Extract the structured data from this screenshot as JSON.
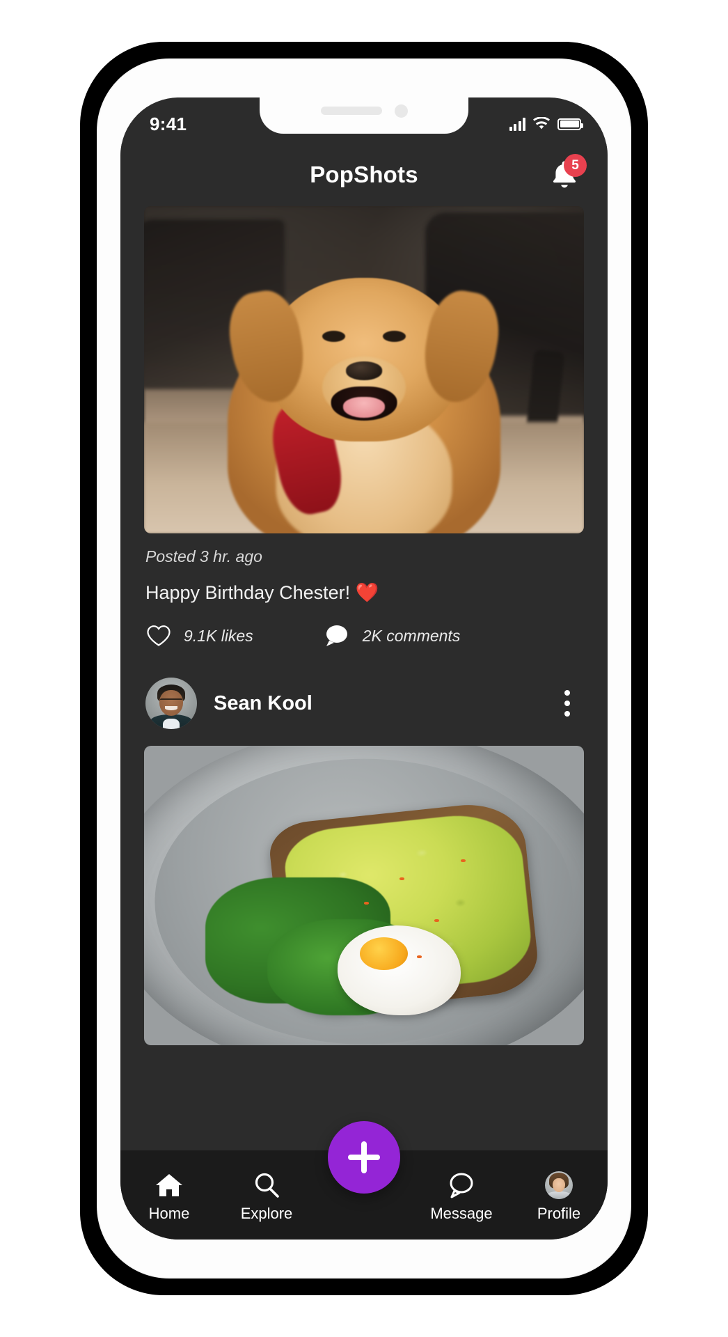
{
  "status_bar": {
    "time": "9:41",
    "signal_icon": "cellular-signal-icon",
    "wifi_icon": "wifi-icon",
    "battery_icon": "battery-icon"
  },
  "header": {
    "title": "PopShots",
    "notifications_icon": "bell-icon",
    "notifications_count": "5",
    "badge_color": "#e8414f"
  },
  "feed": {
    "posts": [
      {
        "image_alt": "golden-retriever-photo",
        "posted": "Posted 3 hr. ago",
        "caption": "Happy Birthday Chester!",
        "caption_emoji": "❤️",
        "likes": "9.1K likes",
        "comments": "2K comments",
        "like_icon": "heart-outline-icon",
        "comment_icon": "comment-bubble-icon"
      },
      {
        "author": "Sean Kool",
        "avatar_alt": "sean-kool-avatar",
        "more_icon": "more-vertical-icon",
        "image_alt": "avocado-toast-photo"
      }
    ]
  },
  "bottom_nav": {
    "items": [
      {
        "label": "Home",
        "icon": "home-icon"
      },
      {
        "label": "Explore",
        "icon": "search-icon"
      },
      {
        "label": "Message",
        "icon": "message-bubble-icon"
      },
      {
        "label": "Profile",
        "icon": "profile-avatar-icon"
      }
    ],
    "fab": {
      "icon": "plus-icon",
      "color": "#9425d6"
    }
  }
}
